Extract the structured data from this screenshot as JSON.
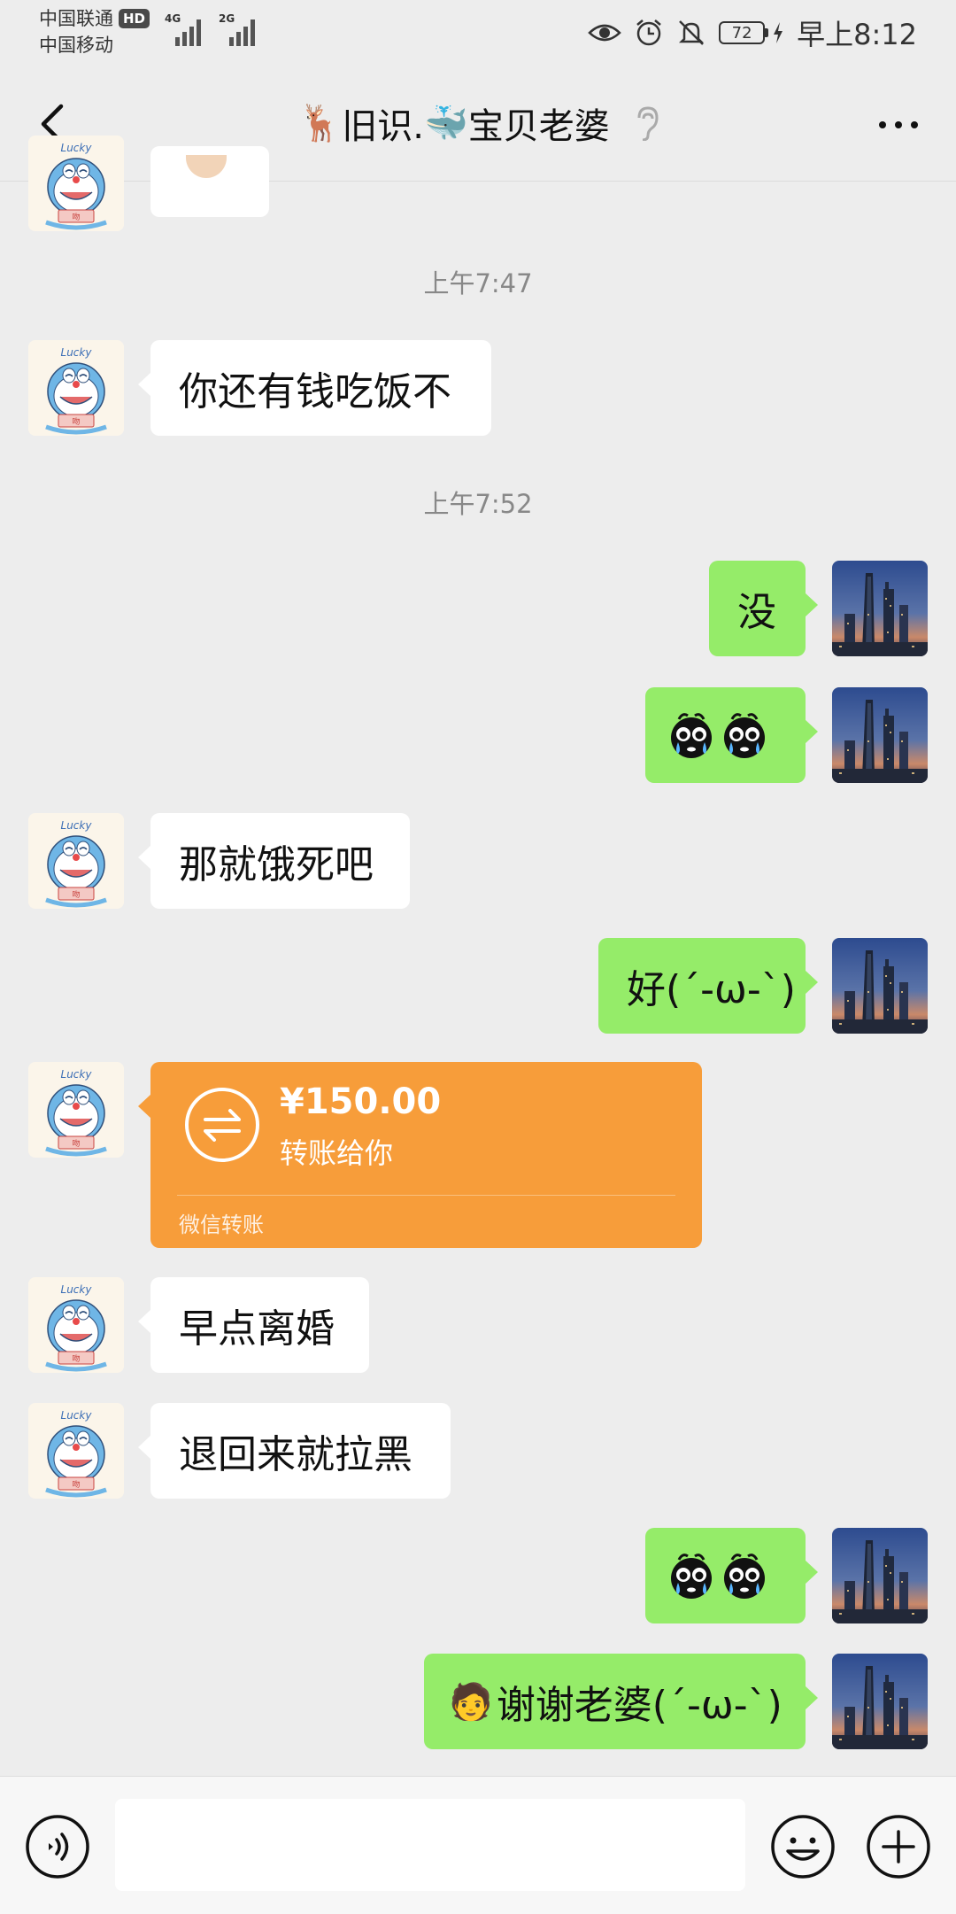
{
  "status_bar": {
    "carrier_1": "中国联通",
    "hd_badge": "HD",
    "carrier_2": "中国移动",
    "network_1": "4G",
    "network_2": "2G",
    "battery_level": "72",
    "time": "早上8:12"
  },
  "header": {
    "title_emoji_left": "🦌",
    "title_part1": "旧识.",
    "title_emoji_mid": "🐳",
    "title_part2": "宝贝老婆"
  },
  "messages": {
    "ts_1": "上午7:47",
    "msg_1": "你还有钱吃饭不",
    "ts_2": "上午7:52",
    "msg_2": "没",
    "msg_4": "那就饿死吧",
    "msg_5": "好(´-ω-`)",
    "msg_7": "早点离婚",
    "msg_8": "退回来就拉黑",
    "msg_10_emoji": "🧑",
    "msg_10_text": "谢谢老婆(´-ω-`)"
  },
  "transfer": {
    "amount": "¥150.00",
    "desc": "转账给你",
    "footer": "微信转账"
  },
  "input_bar": {
    "value": ""
  },
  "colors": {
    "background": "#ededed",
    "bubble_self": "#95ec69",
    "bubble_other": "#ffffff",
    "transfer": "#f79d3a"
  }
}
